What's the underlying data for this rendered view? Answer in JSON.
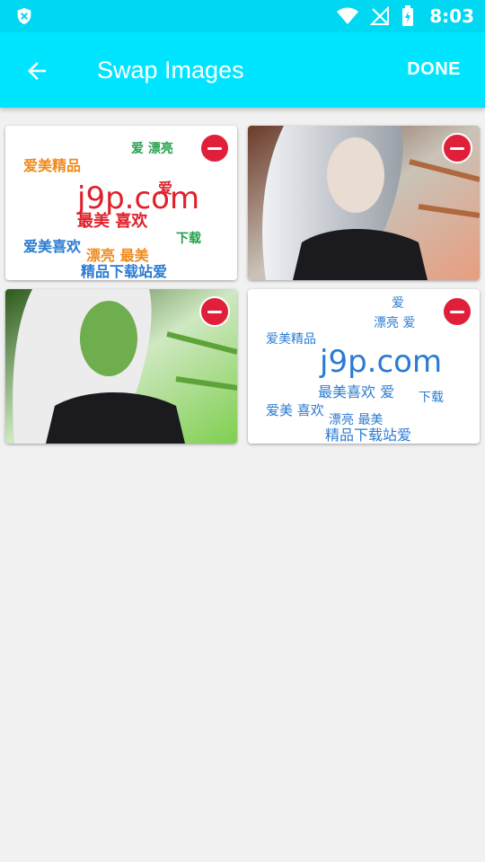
{
  "status_bar": {
    "time": "8:03"
  },
  "app_bar": {
    "title": "Swap Images",
    "done_label": "DONE"
  },
  "images": [
    {
      "kind": "wordcloud",
      "brand_text": "j9p.com",
      "palette": [
        "#e0202a",
        "#f08a1c",
        "#2a7bd2",
        "#22a04a"
      ],
      "accent": "#e0202a"
    },
    {
      "kind": "portrait",
      "palette": [
        "#cfd2d6",
        "#1b1b1f",
        "#e89d7f"
      ]
    },
    {
      "kind": "portrait",
      "palette": [
        "#6fae4e",
        "#e8e8e8",
        "#1b1b1f"
      ]
    },
    {
      "kind": "wordcloud",
      "brand_text": "j9p.com",
      "palette": [
        "#2a7bd2"
      ],
      "accent": "#2a7bd2"
    }
  ],
  "icons": [
    "shield-x-icon",
    "wifi-icon",
    "no-signal-icon",
    "battery-charging-icon",
    "arrow-back-icon",
    "remove-circle-icon"
  ]
}
